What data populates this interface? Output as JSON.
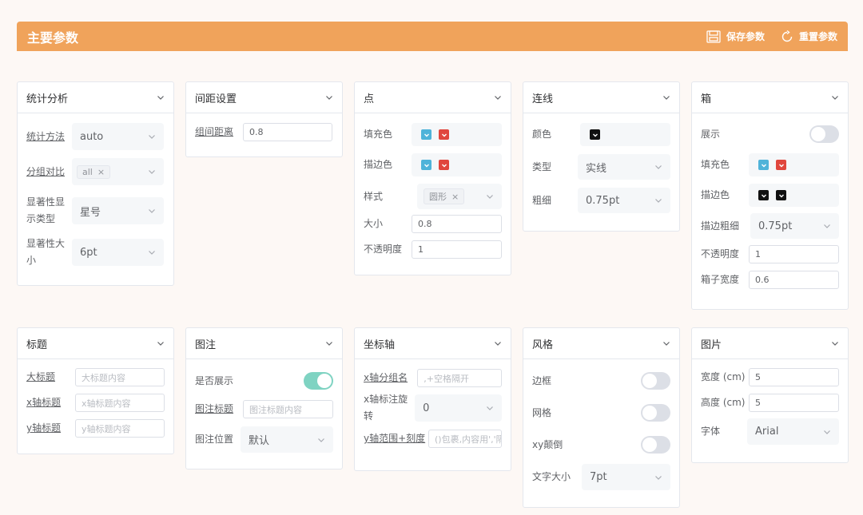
{
  "header": {
    "title": "主要参数",
    "save": "保存参数",
    "reset": "重置参数"
  },
  "stats": {
    "title": "统计分析",
    "method_label": "统计方法",
    "method_value": "auto",
    "group_label": "分组对比",
    "group_tag": "all",
    "sig_type_label_1": "显著性显",
    "sig_type_label_2": "示类型",
    "sig_type_value": "星号",
    "sig_size_label_1": "显著性大",
    "sig_size_label_2": "小",
    "sig_size_value": "6pt"
  },
  "spacing": {
    "title": "间距设置",
    "gap_label": "组间距离",
    "gap_value": "0.8"
  },
  "point": {
    "title": "点",
    "fill_label": "填充色",
    "stroke_label": "描边色",
    "style_label": "样式",
    "style_tag": "圆形",
    "size_label": "大小",
    "size_value": "0.8",
    "opacity_label": "不透明度",
    "opacity_value": "1"
  },
  "line": {
    "title": "连线",
    "color_label": "颜色",
    "type_label": "类型",
    "type_value": "实线",
    "width_label": "粗细",
    "width_value": "0.75pt"
  },
  "box": {
    "title": "箱",
    "show_label": "展示",
    "fill_label": "填充色",
    "stroke_label": "描边色",
    "stroke_w_label": "描边粗细",
    "stroke_w_value": "0.75pt",
    "opacity_label": "不透明度",
    "opacity_value": "1",
    "width_label": "箱子宽度",
    "width_value": "0.6"
  },
  "titles": {
    "title": "标题",
    "main_label": "大标题",
    "main_ph": "大标题内容",
    "x_label": "x轴标题",
    "x_ph": "x轴标题内容",
    "y_label": "y轴标题",
    "y_ph": "y轴标题内容"
  },
  "legend": {
    "title": "图注",
    "show_label": "是否展示",
    "title_label": "图注标题",
    "title_ph": "图注标题内容",
    "pos_label": "图注位置",
    "pos_value": "默认"
  },
  "axis": {
    "title": "坐标轴",
    "xgroup_label": "x轴分组名",
    "xgroup_ph": ",+空格隔开",
    "xrot_label_1": "x轴标注旋",
    "xrot_label_2": "转",
    "xrot_value": "0",
    "yrange_label": "y轴范围+刻度",
    "yrange_ph": "()包裹,内容用','隔开"
  },
  "style": {
    "title": "风格",
    "border_label": "边框",
    "grid_label": "网格",
    "flip_label": "xy颠倒",
    "font_size_label": "文字大小",
    "font_size_value": "7pt"
  },
  "image": {
    "title": "图片",
    "width_label": "宽度 (cm)",
    "width_value": "5",
    "height_label": "高度 (cm)",
    "height_value": "5",
    "font_label": "字体",
    "font_value": "Arial"
  },
  "colors": {
    "accent": "#f0a35b",
    "blue": "#4fb3d9",
    "red": "#e0463d",
    "black": "#111111",
    "toggle_on": "#7fd3c2"
  }
}
